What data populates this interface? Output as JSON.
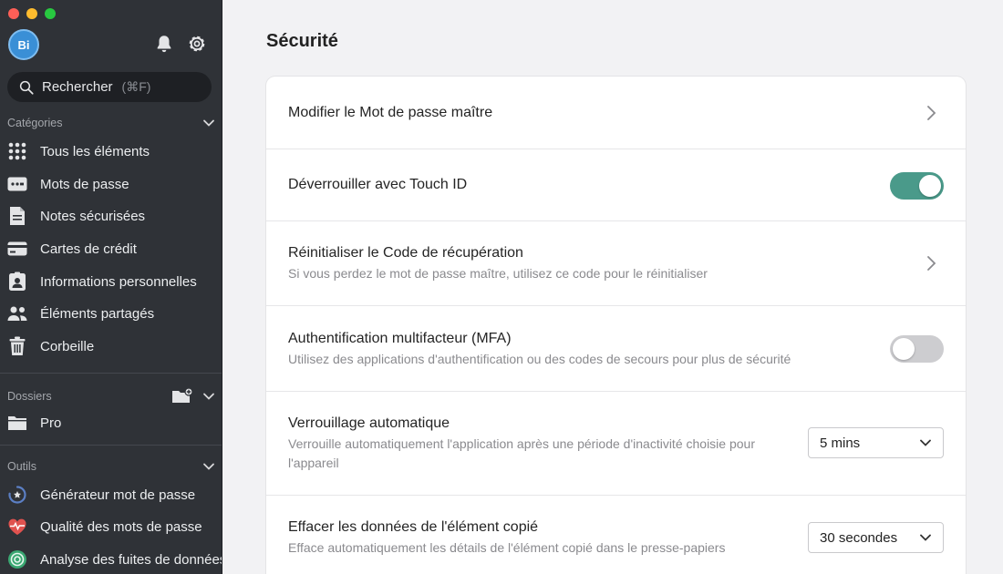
{
  "avatar_initials": "Bi",
  "search": {
    "label": "Rechercher",
    "shortcut": "(⌘F)"
  },
  "sidebar": {
    "categories_label": "Catégories",
    "categories": [
      {
        "label": "Tous les éléments",
        "icon": "grid-icon"
      },
      {
        "label": "Mots de passe",
        "icon": "password-card-icon"
      },
      {
        "label": "Notes sécurisées",
        "icon": "note-icon"
      },
      {
        "label": "Cartes de crédit",
        "icon": "credit-card-icon"
      },
      {
        "label": "Informations personnelles",
        "icon": "id-badge-icon"
      },
      {
        "label": "Éléments partagés",
        "icon": "people-icon"
      },
      {
        "label": "Corbeille",
        "icon": "trash-icon"
      }
    ],
    "folders_label": "Dossiers",
    "folders": [
      {
        "label": "Pro",
        "icon": "folder-icon"
      }
    ],
    "tools_label": "Outils",
    "tools": [
      {
        "label": "Générateur mot de passe",
        "icon": "generator-icon"
      },
      {
        "label": "Qualité des mots de passe",
        "icon": "heart-pulse-icon"
      },
      {
        "label": "Analyse des fuites de données",
        "icon": "radar-icon"
      }
    ]
  },
  "main": {
    "title": "Sécurité",
    "rows": {
      "master": {
        "title": "Modifier le Mot de passe maître"
      },
      "touchid": {
        "title": "Déverrouiller avec Touch ID",
        "enabled": true
      },
      "recovery": {
        "title": "Réinitialiser le Code de récupération",
        "desc": "Si vous perdez le mot de passe maître, utilisez ce code pour le réinitialiser"
      },
      "mfa": {
        "title": "Authentification multifacteur (MFA)",
        "desc": "Utilisez des applications d'authentification ou des codes de secours pour plus de sécurité",
        "enabled": false
      },
      "autolock": {
        "title": "Verrouillage automatique",
        "desc": "Verrouille automatiquement l'application après une période d'inactivité choisie pour l'appareil",
        "value": "5 mins"
      },
      "clipboard": {
        "title": "Effacer les données de l'élément copié",
        "desc": "Efface automatiquement les détails de l'élément copié dans le presse-papiers",
        "value": "30 secondes"
      }
    }
  },
  "colors": {
    "sidebar_bg": "#2f3237",
    "toggle_on": "#4a9a8a",
    "toggle_off": "#cdcdd0",
    "page_bg": "#f2f2f4"
  }
}
